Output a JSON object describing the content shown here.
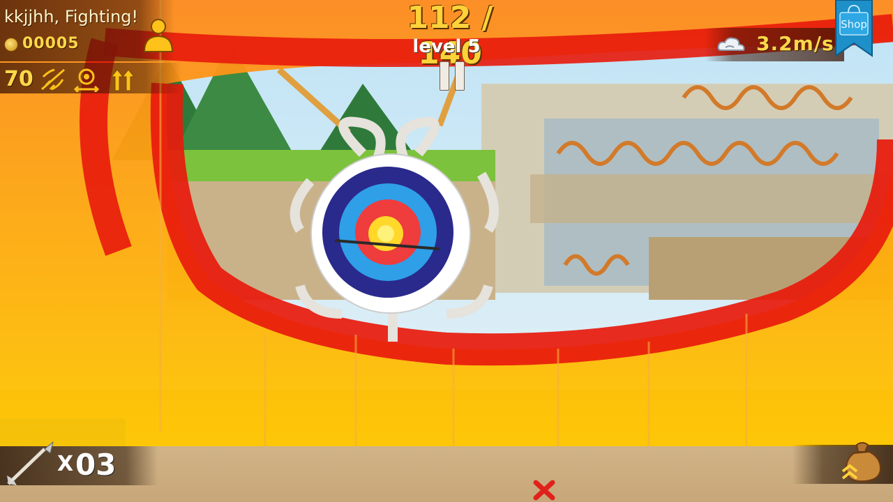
{
  "player": {
    "name": "kkjjhh, Fighting!",
    "coins": "00005"
  },
  "stats": {
    "value": "70"
  },
  "score": {
    "current_total": "112 / 140"
  },
  "level": {
    "label": "level 5"
  },
  "wind": {
    "speed": "3.2m/s"
  },
  "shop": {
    "label": "Shop"
  },
  "arrows": {
    "multiplier": "X",
    "count": "03"
  },
  "icons": {
    "profile": "person-icon",
    "power": "bow-power-icon",
    "aim": "target-aim-icon",
    "upgrade": "double-arrow-up-icon",
    "wind": "cloud-wind-icon",
    "arrow": "arrow-icon",
    "bag": "money-bag-icon",
    "miss": "red-x-icon",
    "pause": "pause-icon"
  },
  "colors": {
    "accent": "#ffd23a",
    "panel": "#3c1405",
    "shop": "#1d8fc9"
  }
}
